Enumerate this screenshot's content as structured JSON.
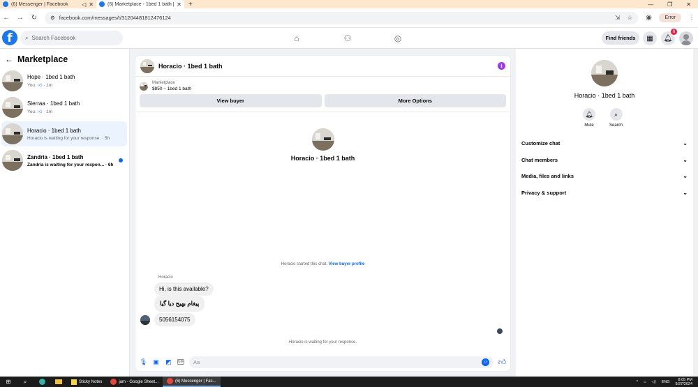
{
  "browser": {
    "tabs": [
      {
        "title": "(6) Messenger | Facebook"
      },
      {
        "title": "(6) Marketplace - 1bed 1 bath |"
      }
    ],
    "url": "facebook.com/messages/t/31204481812476124",
    "profile_button": "Error"
  },
  "header": {
    "search_placeholder": "Search Facebook",
    "find_friends": "Find friends",
    "notification_count": "6"
  },
  "sidebar": {
    "title": "Marketplace",
    "conversations": [
      {
        "name": "Hope · 1bed 1 bath",
        "prefix": "You:",
        "time": "· 1m"
      },
      {
        "name": "Sierraa · 1bed 1 bath",
        "prefix": "You:",
        "time": "· 1m"
      },
      {
        "name": "Horacio · 1bed 1 bath",
        "preview": "Horacio is waiting for your response. · 5h"
      },
      {
        "name": "Zandria · 1bed 1 bath",
        "preview": "Zandria is waiting for your respon... · 6h"
      }
    ]
  },
  "chat": {
    "title": "Horacio · 1bed 1 bath",
    "listing_label": "Marketplace",
    "listing_price": "$850 – 1bed 1 bath",
    "view_buyer": "View buyer",
    "more_options": "More Options",
    "hero_name": "Horacio · 1bed 1 bath",
    "started_text": "Horacio started this chat.",
    "buyer_profile_link": "View buyer profile",
    "sender": "Horacio",
    "messages": [
      "Hi, is this available?",
      "پیغام بھیج دیا گیا",
      "5056154075"
    ],
    "waiting_text": "Horacio is waiting for your response.",
    "input_placeholder": "Aa"
  },
  "details": {
    "name": "Horacio · 1bed 1 bath",
    "actions": [
      "Mute",
      "Search"
    ],
    "sections": [
      "Customize chat",
      "Chat members",
      "Media, files and links",
      "Privacy & support"
    ]
  },
  "taskbar": {
    "apps": [
      "Sticky Notes",
      "jam - Google Sheet...",
      "(6) Messenger | Fac..."
    ],
    "lang": "ENG",
    "time": "8:05 PM",
    "date": "9/27/2024"
  },
  "colors": {
    "brand": "#1877f2",
    "messenger_blue": "#0866ff",
    "badge": "#e41e3f",
    "info": "#a033ff",
    "tab_strip": "#fde7cf"
  }
}
